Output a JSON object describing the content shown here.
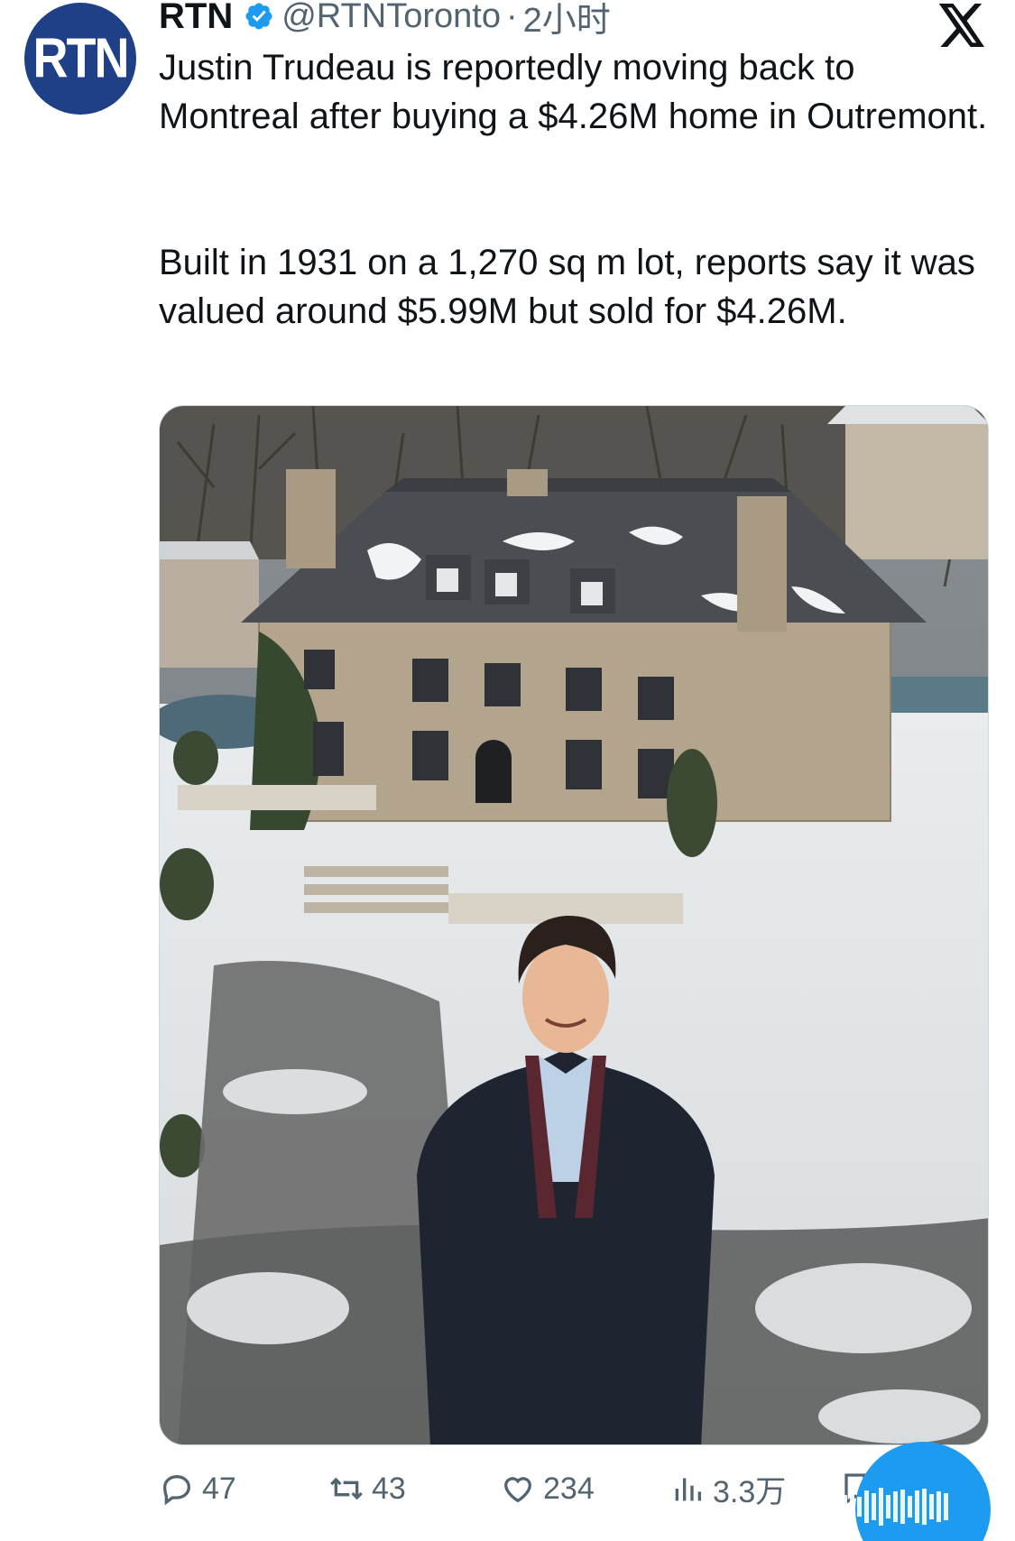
{
  "author": {
    "avatar_text": "RTN",
    "display_name": "RTN",
    "handle": "@RTNToronto",
    "separator": "·",
    "time": "2小时"
  },
  "tweet": {
    "paragraph1": "Justin Trudeau is reportedly moving back to Montreal after buying a $4.26M home in Outremont.",
    "paragraph2": "Built in 1931 on a 1,270 sq m lot, reports say it was valued around $5.99M but sold for $4.26M."
  },
  "actions": {
    "replies": "47",
    "retweets": "43",
    "likes": "234",
    "views": "3.3万"
  },
  "colors": {
    "accent": "#1d9bf0",
    "avatar_bg": "#1f3f86",
    "muted_text": "#536471"
  },
  "icons": [
    "verified-badge-icon",
    "x-logo-icon",
    "reply-icon",
    "retweet-icon",
    "like-icon",
    "views-icon",
    "bookmark-icon"
  ]
}
